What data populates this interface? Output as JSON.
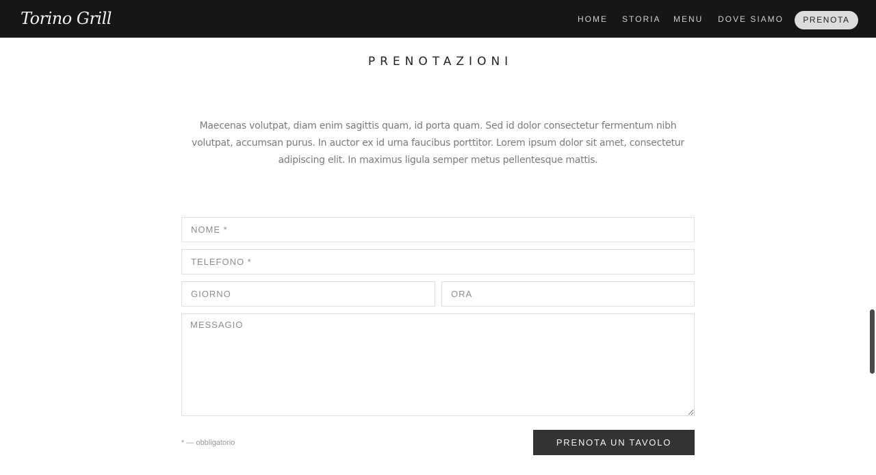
{
  "header": {
    "logo_text": "Torino Grill",
    "nav": {
      "home": "HOME",
      "storia": "STORIA",
      "menu": "MENU",
      "dove_siamo": "DOVE SIAMO",
      "prenota": "PRENOTA"
    }
  },
  "section": {
    "title": "PRENOTAZIONI",
    "intro": "Maecenas volutpat, diam enim sagittis quam, id porta quam. Sed id dolor consectetur fermentum nibh volutpat, accumsan purus. In auctor ex id urna faucibus porttitor. Lorem ipsum dolor sit amet, consectetur adipiscing elit. In maximus ligula semper metus pellentesque mattis."
  },
  "form": {
    "nome_placeholder": "NOME *",
    "telefono_placeholder": "TELEFONO *",
    "giorno_placeholder": "GIORNO",
    "ora_placeholder": "ORA",
    "messagio_placeholder": "MESSAGIO",
    "required_note": "* — obbligatorio",
    "submit_label": "PRENOTA UN TAVOLO"
  },
  "colors": {
    "navbar_bg": "#161616",
    "button_dark": "#333333",
    "pill_bg": "#dcdcdc"
  }
}
